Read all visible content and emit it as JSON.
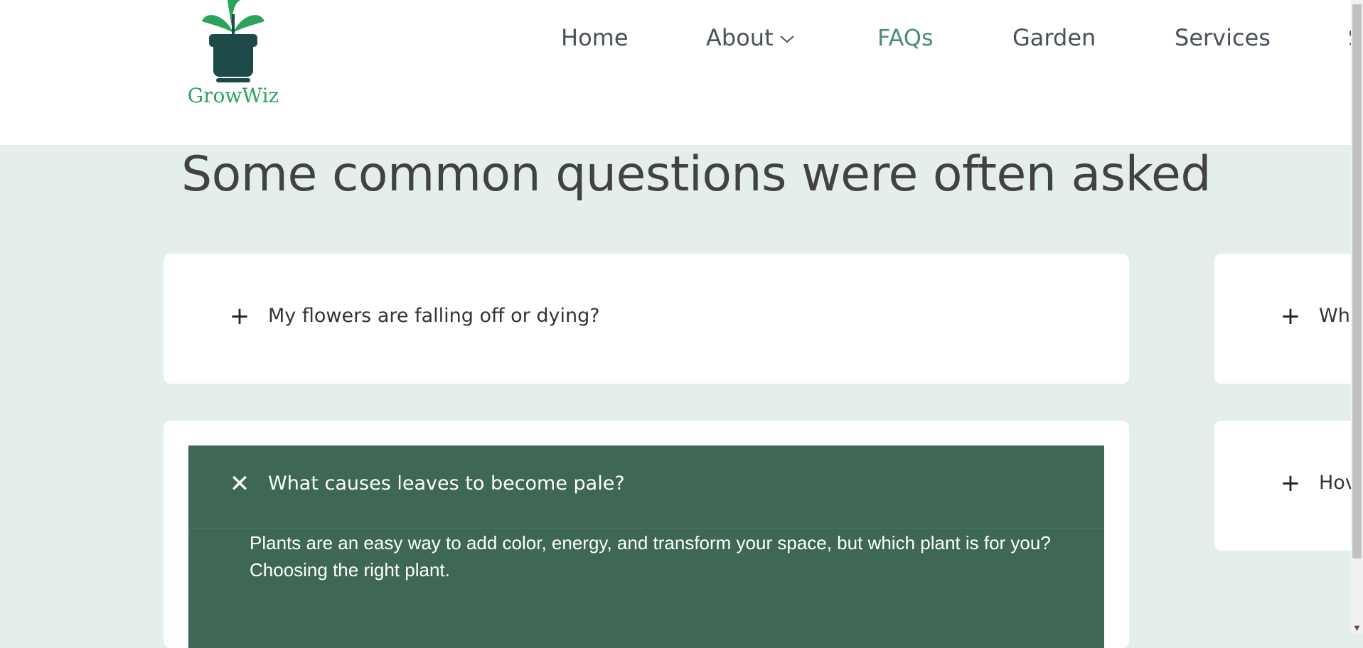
{
  "logo": {
    "text": "GrowWiz",
    "icon": "plant-pot-icon"
  },
  "nav": {
    "items": [
      {
        "label": "Home"
      },
      {
        "label": "About"
      },
      {
        "label": "FAQs"
      },
      {
        "label": "Garden"
      },
      {
        "label": "Services"
      }
    ],
    "active": "FAQs"
  },
  "page": {
    "heading": "Some common questions were often asked"
  },
  "faqs": {
    "left": [
      {
        "question": "My flowers are falling off or dying?",
        "state": "collapsed",
        "icon": "plus-icon"
      },
      {
        "question": "What causes leaves to become pale?",
        "state": "expanded",
        "icon": "close-icon",
        "answer": "Plants are an easy way to add color, energy, and transform your space, but which plant is for you? Choosing the right plant."
      }
    ],
    "right": [
      {
        "question": "Wh",
        "state": "collapsed",
        "icon": "plus-icon"
      },
      {
        "question": "Hov",
        "state": "collapsed",
        "icon": "plus-icon"
      }
    ]
  },
  "colors": {
    "accent": "#4b8e77",
    "panel": "#3e6755",
    "background": "#e4eeea",
    "logo_green": "#2aa35c",
    "logo_dark": "#1d4a48"
  }
}
